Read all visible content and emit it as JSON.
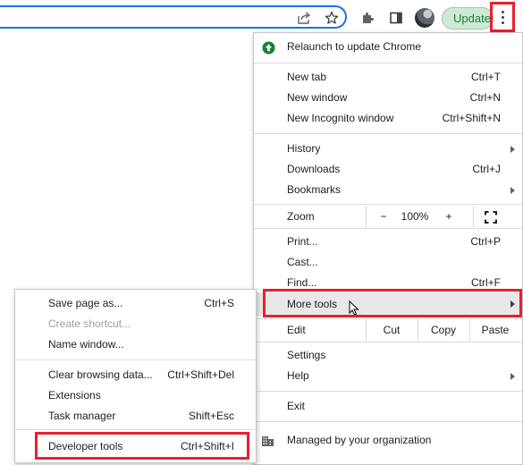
{
  "toolbar": {
    "update_label": "Update"
  },
  "main_menu": {
    "relaunch": "Relaunch to update Chrome",
    "new_tab": {
      "label": "New tab",
      "shortcut": "Ctrl+T"
    },
    "new_window": {
      "label": "New window",
      "shortcut": "Ctrl+N"
    },
    "incognito": {
      "label": "New Incognito window",
      "shortcut": "Ctrl+Shift+N"
    },
    "history": {
      "label": "History"
    },
    "downloads": {
      "label": "Downloads",
      "shortcut": "Ctrl+J"
    },
    "bookmarks": {
      "label": "Bookmarks"
    },
    "zoom": {
      "label": "Zoom",
      "minus": "−",
      "value": "100%",
      "plus": "+"
    },
    "print": {
      "label": "Print...",
      "shortcut": "Ctrl+P"
    },
    "cast": {
      "label": "Cast..."
    },
    "find": {
      "label": "Find...",
      "shortcut": "Ctrl+F"
    },
    "more_tools": {
      "label": "More tools"
    },
    "edit": {
      "label": "Edit",
      "cut": "Cut",
      "copy": "Copy",
      "paste": "Paste"
    },
    "settings": {
      "label": "Settings"
    },
    "help": {
      "label": "Help"
    },
    "exit": {
      "label": "Exit"
    },
    "managed": "Managed by your organization"
  },
  "sub_menu": {
    "save_page": {
      "label": "Save page as...",
      "shortcut": "Ctrl+S"
    },
    "create_shortcut": {
      "label": "Create shortcut..."
    },
    "name_window": {
      "label": "Name window..."
    },
    "clear_data": {
      "label": "Clear browsing data...",
      "shortcut": "Ctrl+Shift+Del"
    },
    "extensions": {
      "label": "Extensions"
    },
    "task_manager": {
      "label": "Task manager",
      "shortcut": "Shift+Esc"
    },
    "dev_tools": {
      "label": "Developer tools",
      "shortcut": "Ctrl+Shift+I"
    }
  },
  "icons": [
    "share-icon",
    "star-icon",
    "puzzle-icon",
    "side-panel-icon",
    "avatar",
    "kebab-menu-icon",
    "update-arrow-icon",
    "fullscreen-icon",
    "mouse-cursor-icon",
    "building-icon"
  ],
  "colors": {
    "highlight": "#e8202e",
    "accent": "#1a73e8",
    "update_green": "#188038"
  }
}
